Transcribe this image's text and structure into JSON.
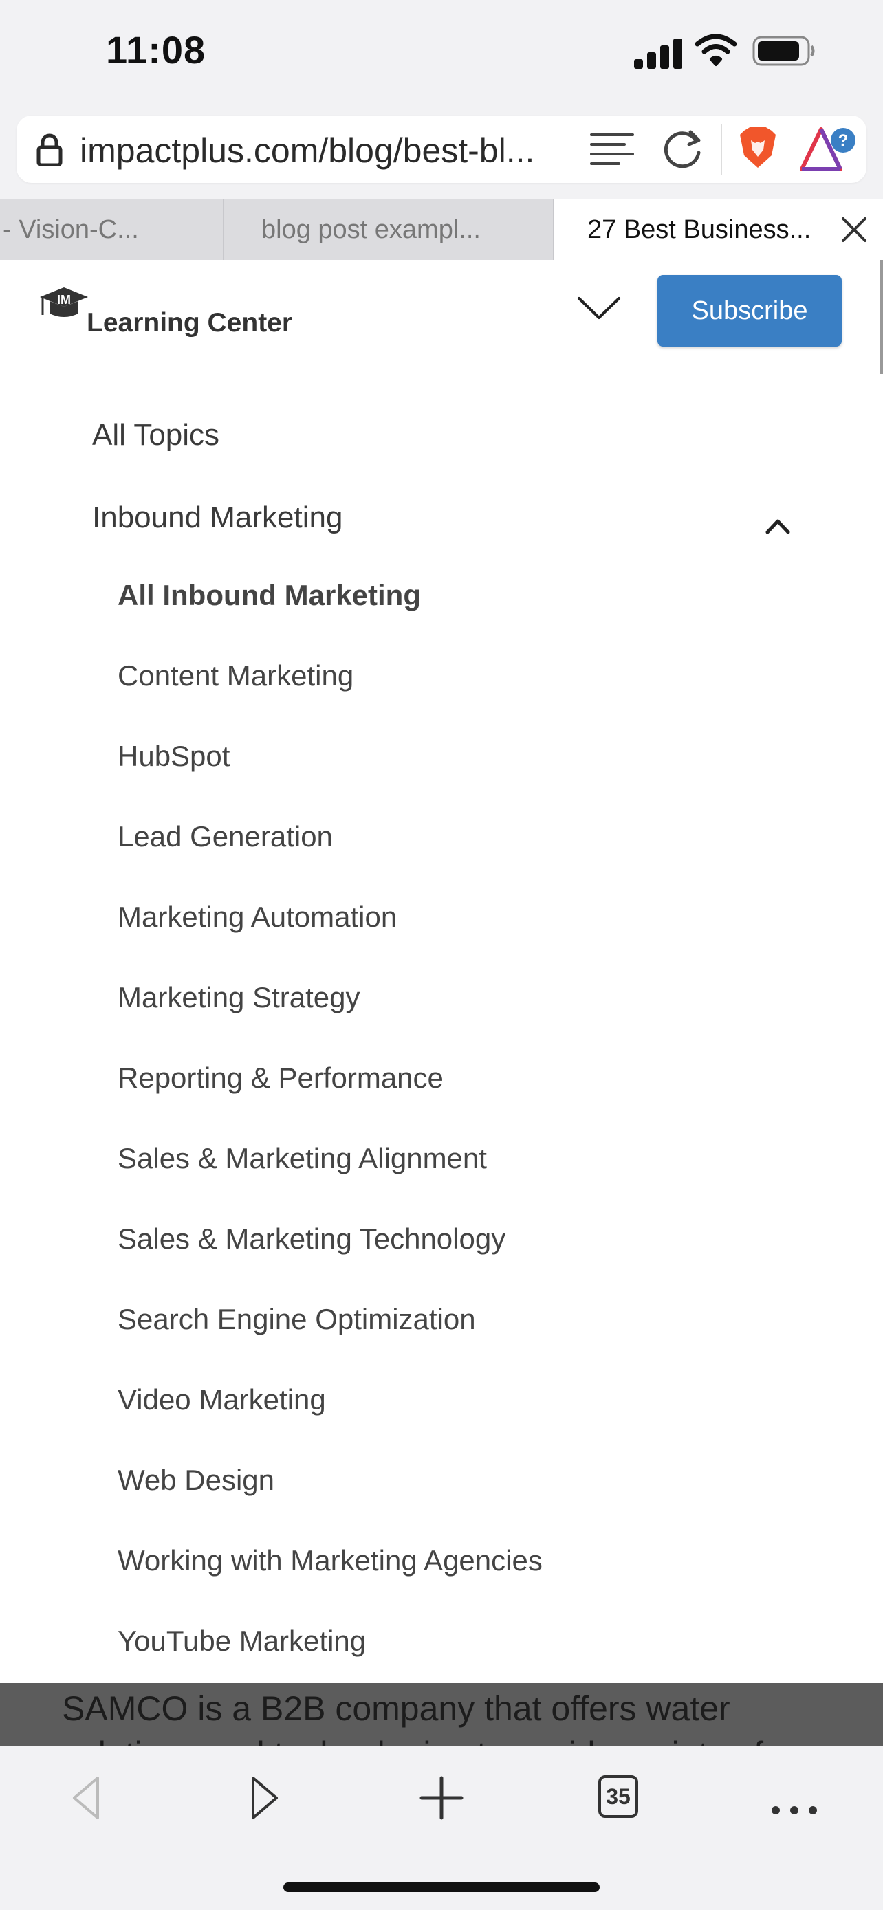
{
  "status_bar": {
    "time": "11:08"
  },
  "browser": {
    "url_display": "impactplus.com/blog/best-bl...",
    "tabs": [
      {
        "label": "- Vision-C..."
      },
      {
        "label": "blog post exampl..."
      },
      {
        "label": "27 Best Business..."
      }
    ],
    "tab_count": "35"
  },
  "header": {
    "logo_text": "Learning Center",
    "logo_mark": "IM",
    "subscribe_label": "Subscribe"
  },
  "menu": {
    "all_topics": "All Topics",
    "inbound_marketing": "Inbound Marketing",
    "sub_items": [
      {
        "label": "All Inbound Marketing"
      },
      {
        "label": "Content Marketing"
      },
      {
        "label": "HubSpot"
      },
      {
        "label": "Lead Generation"
      },
      {
        "label": "Marketing Automation"
      },
      {
        "label": "Marketing Strategy"
      },
      {
        "label": "Reporting & Performance"
      },
      {
        "label": "Sales & Marketing Alignment"
      },
      {
        "label": "Sales & Marketing Technology"
      },
      {
        "label": "Search Engine Optimization"
      },
      {
        "label": "Video Marketing"
      },
      {
        "label": "Web Design"
      },
      {
        "label": "Working with Marketing Agencies"
      },
      {
        "label": "YouTube Marketing"
      }
    ]
  },
  "article_peek": {
    "line1": "SAMCO is a B2B company that offers water",
    "line2": "solutions and technologies to a wide variety of"
  },
  "colors": {
    "accent": "#3a7fc4",
    "brave_orange": "#f1562b"
  }
}
